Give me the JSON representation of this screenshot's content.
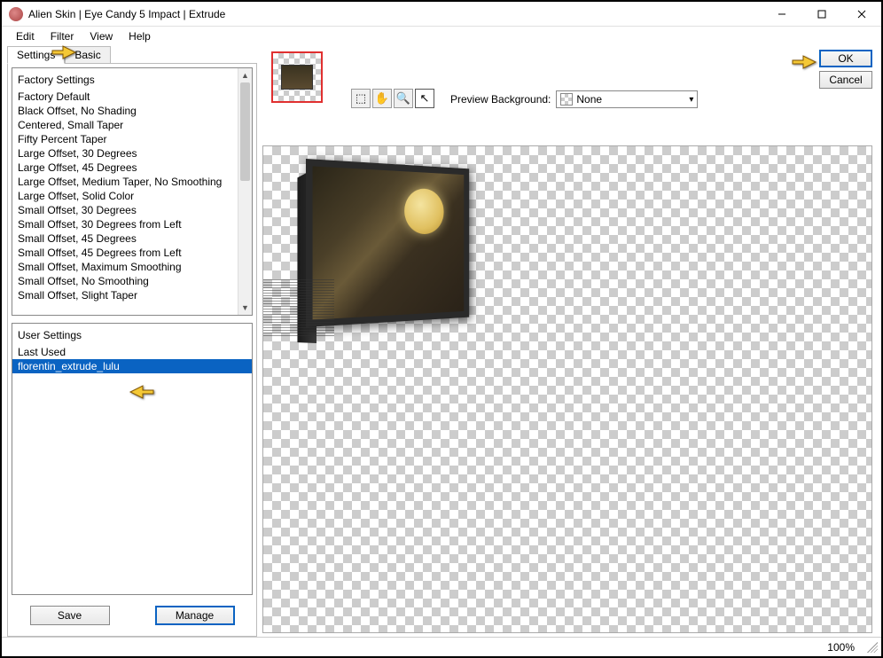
{
  "window": {
    "title": "Alien Skin | Eye Candy 5 Impact | Extrude"
  },
  "menu": {
    "edit": "Edit",
    "filter": "Filter",
    "view": "View",
    "help": "Help"
  },
  "tabs": {
    "settings": "Settings",
    "basic": "Basic"
  },
  "factory": {
    "header": "Factory Settings",
    "items": [
      "Factory Default",
      "Black Offset, No Shading",
      "Centered, Small Taper",
      "Fifty Percent Taper",
      "Large Offset, 30 Degrees",
      "Large Offset, 45 Degrees",
      "Large Offset, Medium Taper, No Smoothing",
      "Large Offset, Solid Color",
      "Small Offset, 30 Degrees",
      "Small Offset, 30 Degrees from Left",
      "Small Offset, 45 Degrees",
      "Small Offset, 45 Degrees from Left",
      "Small Offset, Maximum Smoothing",
      "Small Offset, No Smoothing",
      "Small Offset, Slight Taper"
    ]
  },
  "user": {
    "header": "User Settings",
    "items": [
      "Last Used",
      "florentin_extrude_lulu"
    ],
    "selectedIndex": 1
  },
  "buttons": {
    "save": "Save",
    "manage": "Manage",
    "ok": "OK",
    "cancel": "Cancel"
  },
  "preview": {
    "bgLabel": "Preview Background:",
    "bgValue": "None"
  },
  "watermark": "claudia",
  "status": {
    "zoom": "100%"
  },
  "icons": {
    "marquee": "⬚",
    "hand": "✋",
    "zoom": "🔍",
    "pointer": "↖"
  }
}
